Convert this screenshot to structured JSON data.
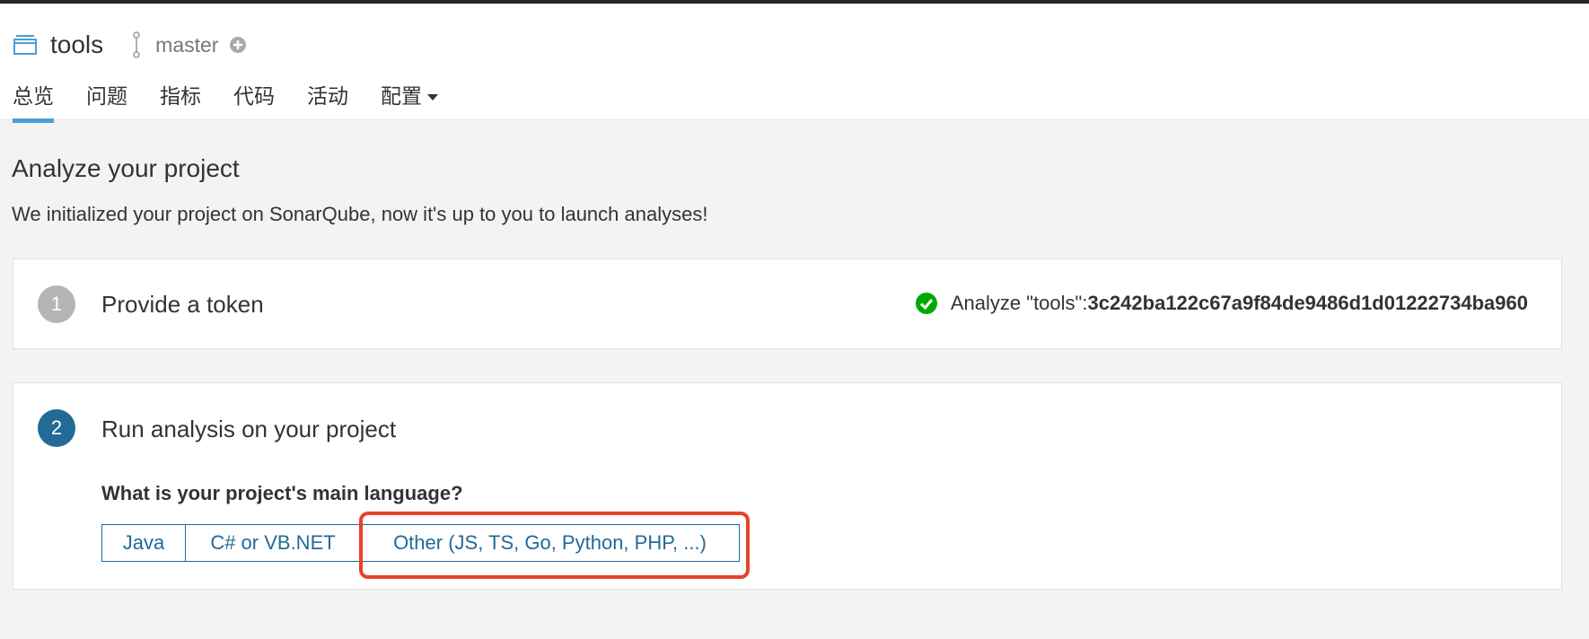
{
  "project": {
    "name": "tools",
    "branch": "master"
  },
  "nav": {
    "items": [
      {
        "label": "总览",
        "active": true
      },
      {
        "label": "问题"
      },
      {
        "label": "指标"
      },
      {
        "label": "代码"
      },
      {
        "label": "活动"
      },
      {
        "label": "配置"
      }
    ]
  },
  "page": {
    "title": "Analyze your project",
    "description": "We initialized your project on SonarQube, now it's up to you to launch analyses!"
  },
  "step1": {
    "number": "1",
    "title": "Provide a token",
    "token_label": "Analyze \"tools\":",
    "token_value": "3c242ba122c67a9f84de9486d1d01222734ba960"
  },
  "step2": {
    "number": "2",
    "title": "Run analysis on your project",
    "question": "What is your project's main language?",
    "languages": [
      "Java",
      "C# or VB.NET",
      "Other (JS, TS, Go, Python, PHP, ...)"
    ]
  },
  "colors": {
    "accent": "#4b9fd5",
    "step_active": "#236a97",
    "step_done": "#b5b5b5",
    "success": "#00aa00",
    "highlight": "#e8412a"
  }
}
